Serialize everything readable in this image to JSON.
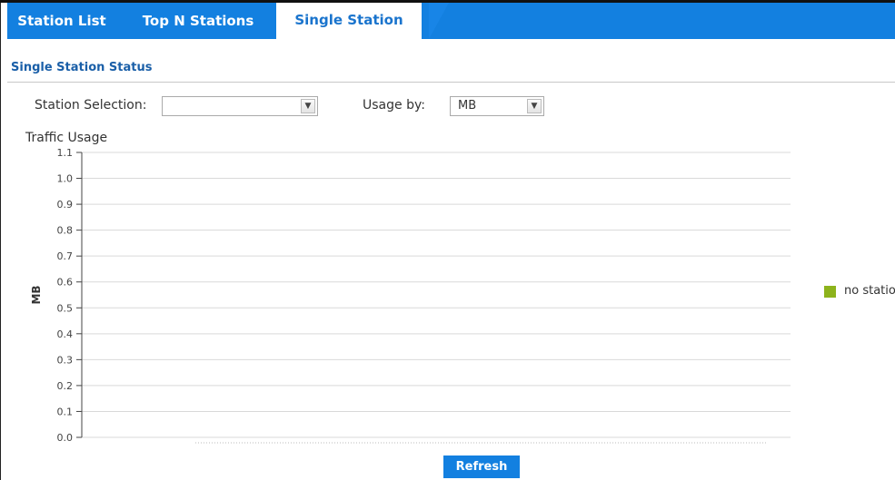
{
  "tabs": [
    {
      "label": "Station List",
      "active": false
    },
    {
      "label": "Top N Stations",
      "active": false
    },
    {
      "label": "Single Station",
      "active": true
    }
  ],
  "section": {
    "title": "Single Station Status"
  },
  "controls": {
    "station_selection_label": "Station Selection:",
    "station_selection_value": "",
    "usage_by_label": "Usage by:",
    "usage_by_value": "MB"
  },
  "chart_data": {
    "type": "line",
    "title": "Traffic Usage",
    "xlabel": "",
    "ylabel": "MB",
    "ylim": [
      0.0,
      1.1
    ],
    "yticks": [
      "0.0",
      "0.1",
      "0.2",
      "0.3",
      "0.4",
      "0.5",
      "0.6",
      "0.7",
      "0.8",
      "0.9",
      "1.0",
      "1.1"
    ],
    "grid": true,
    "legend_position": "right",
    "series": [
      {
        "name": "no statio",
        "values": []
      }
    ],
    "colors": {
      "series": "#8db31c"
    }
  },
  "refresh_label": "Refresh",
  "colors": {
    "accent": "#1380e0",
    "section_title": "#1a5fa8"
  }
}
